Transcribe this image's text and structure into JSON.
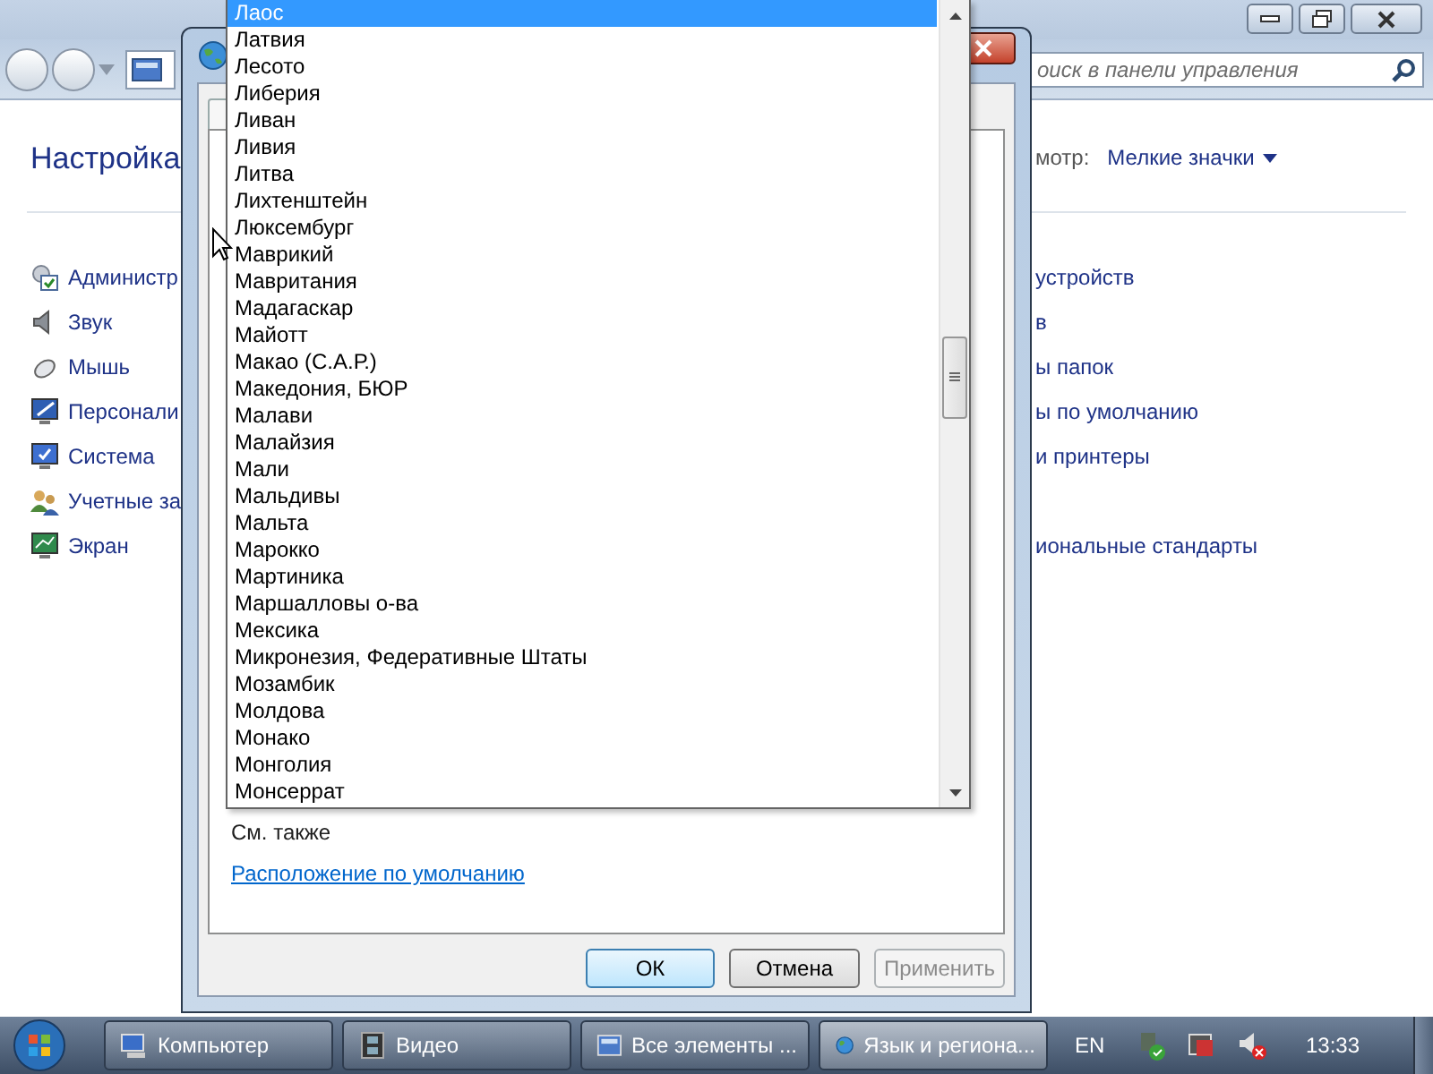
{
  "control_panel": {
    "search": {
      "placeholder": "оиск в панели управления"
    },
    "heading": "Настройка",
    "view_label": "мотр:",
    "view_value": "Мелкие значки",
    "left_items": [
      {
        "kind": "admin",
        "label": "Администр"
      },
      {
        "kind": "sound",
        "label": "Звук"
      },
      {
        "kind": "mouse",
        "label": "Мышь"
      },
      {
        "kind": "paint",
        "label": "Персонали"
      },
      {
        "kind": "system",
        "label": "Система"
      },
      {
        "kind": "users",
        "label": "Учетные за"
      },
      {
        "kind": "display",
        "label": "Экран"
      }
    ],
    "right_items": [
      {
        "kind": "plain",
        "label": "устройств"
      },
      {
        "kind": "plain",
        "label": "в"
      },
      {
        "kind": "plain",
        "label": "ы папок"
      },
      {
        "kind": "plain",
        "label": "ы по умолчанию"
      },
      {
        "kind": "plain",
        "label": "и принтеры"
      },
      {
        "kind": "spaced",
        "label": "иональные стандарты"
      }
    ]
  },
  "dialog": {
    "see_also": "См. также",
    "link": "Расположение по умолчанию",
    "buttons": [
      {
        "label": "ОК",
        "kind": "default",
        "disabled": false
      },
      {
        "label": "Отмена",
        "kind": "normal",
        "disabled": false
      },
      {
        "label": "Применить",
        "kind": "normal",
        "disabled": true
      }
    ]
  },
  "dropdown": {
    "items": [
      {
        "label": "Лаос",
        "selected": true
      },
      {
        "label": "Латвия",
        "selected": false
      },
      {
        "label": "Лесото",
        "selected": false
      },
      {
        "label": "Либерия",
        "selected": false
      },
      {
        "label": "Ливан",
        "selected": false
      },
      {
        "label": "Ливия",
        "selected": false
      },
      {
        "label": "Литва",
        "selected": false
      },
      {
        "label": "Лихтенштейн",
        "selected": false
      },
      {
        "label": "Люксембург",
        "selected": false
      },
      {
        "label": "Маврикий",
        "selected": false
      },
      {
        "label": "Мавритания",
        "selected": false
      },
      {
        "label": "Мадагаскар",
        "selected": false
      },
      {
        "label": "Майотт",
        "selected": false
      },
      {
        "label": "Макао (С.А.Р.)",
        "selected": false
      },
      {
        "label": "Македония, БЮР",
        "selected": false
      },
      {
        "label": "Малави",
        "selected": false
      },
      {
        "label": "Малайзия",
        "selected": false
      },
      {
        "label": "Мали",
        "selected": false
      },
      {
        "label": "Мальдивы",
        "selected": false
      },
      {
        "label": "Мальта",
        "selected": false
      },
      {
        "label": "Марокко",
        "selected": false
      },
      {
        "label": "Мартиника",
        "selected": false
      },
      {
        "label": "Маршалловы о-ва",
        "selected": false
      },
      {
        "label": "Мексика",
        "selected": false
      },
      {
        "label": "Микронезия, Федеративные Штаты",
        "selected": false
      },
      {
        "label": "Мозамбик",
        "selected": false
      },
      {
        "label": "Молдова",
        "selected": false
      },
      {
        "label": "Монако",
        "selected": false
      },
      {
        "label": "Монголия",
        "selected": false
      },
      {
        "label": "Монсеррат",
        "selected": false
      }
    ]
  },
  "taskbar": {
    "buttons": [
      {
        "label": "Компьютер",
        "kind": "computer",
        "selected": false
      },
      {
        "label": "Видео",
        "kind": "video",
        "selected": false
      },
      {
        "label": "Все элементы ...",
        "kind": "panel",
        "selected": false
      },
      {
        "label": "Язык и региона...",
        "kind": "globe",
        "selected": true
      }
    ],
    "language": "EN",
    "clock": "13:33"
  }
}
